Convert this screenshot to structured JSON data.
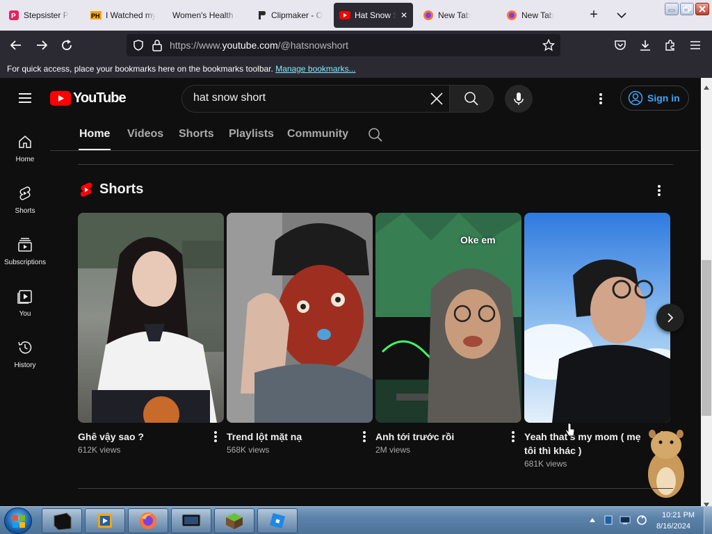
{
  "browser": {
    "tabs": [
      {
        "label": "Stepsister P",
        "fav_color": "#e0245e"
      },
      {
        "label": "I Watched my",
        "fav_color": "#f7a500"
      },
      {
        "label": "Women's Health -",
        "fav_color": ""
      },
      {
        "label": "Clipmaker - O",
        "fav_color": "#3a3a3a"
      },
      {
        "label": "Hat Snow S",
        "fav_color": "#ff0000",
        "active": true
      },
      {
        "label": "New Tab",
        "fav_color": "#ff7139"
      },
      {
        "label": "New Tab",
        "fav_color": "#ff7139"
      }
    ],
    "url_prefix": "https://www.",
    "url_host": "youtube.com",
    "url_path": "/@hatsnowshort",
    "bookmarks_text": "For quick access, place your bookmarks here on the bookmarks toolbar.",
    "bookmarks_link": "Manage bookmarks..."
  },
  "youtube": {
    "logo_text": "YouTube",
    "search_value": "hat snow short",
    "signin_label": "Sign in",
    "guide": [
      {
        "label": "Home",
        "icon": "home-icon"
      },
      {
        "label": "Shorts",
        "icon": "shorts-icon"
      },
      {
        "label": "Subscriptions",
        "icon": "subscriptions-icon"
      },
      {
        "label": "You",
        "icon": "you-icon"
      },
      {
        "label": "History",
        "icon": "history-icon"
      }
    ],
    "channel_tabs": [
      "Home",
      "Videos",
      "Shorts",
      "Playlists",
      "Community"
    ],
    "shelf_title": "Shorts",
    "shorts": [
      {
        "title": "Ghê vậy sao ?",
        "views": "612K views",
        "overlay": ""
      },
      {
        "title": "Trend lột mặt nạ",
        "views": "568K views",
        "overlay": ""
      },
      {
        "title": "Anh tới trước rồi",
        "views": "2M views",
        "overlay": "Oke em"
      },
      {
        "title": "Yeah that's my mom ( mẹ tôi thì khác )",
        "views": "681K views",
        "overlay": ""
      }
    ]
  },
  "taskbar": {
    "time": "10:21 PM",
    "date": "8/16/2024"
  },
  "colors": {
    "yt_red": "#ff0000",
    "link_blue": "#3ea6ff",
    "page_bg": "#0f0f0f"
  }
}
